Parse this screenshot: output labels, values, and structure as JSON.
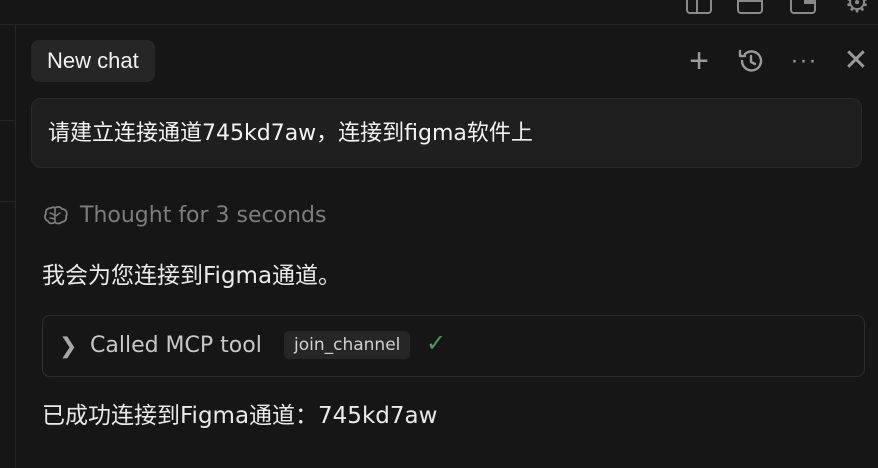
{
  "header": {
    "tab_label": "New chat"
  },
  "icons": {
    "layout_sidebar": "layout-sidebar-icon",
    "layout_panel": "layout-panel-icon",
    "layout_split": "layout-split-icon",
    "settings": "gear-icon",
    "new_chat": "plus-icon",
    "history": "history-icon",
    "more": "more-icon",
    "close": "close-icon"
  },
  "messages": {
    "user": "请建立连接通道745kd7aw，连接到figma软件上",
    "thought": "Thought for 3 seconds",
    "assistant_intro": "我会为您连接到Figma通道。",
    "tool_call": {
      "label": "Called MCP tool",
      "tool_name": "join_channel",
      "status": "success"
    },
    "assistant_result": "已成功连接到Figma通道：745kd7aw"
  },
  "colors": {
    "background": "#161616",
    "bubble": "#1f1f1f",
    "success": "#4c9a62",
    "muted": "#7d7d7d"
  }
}
